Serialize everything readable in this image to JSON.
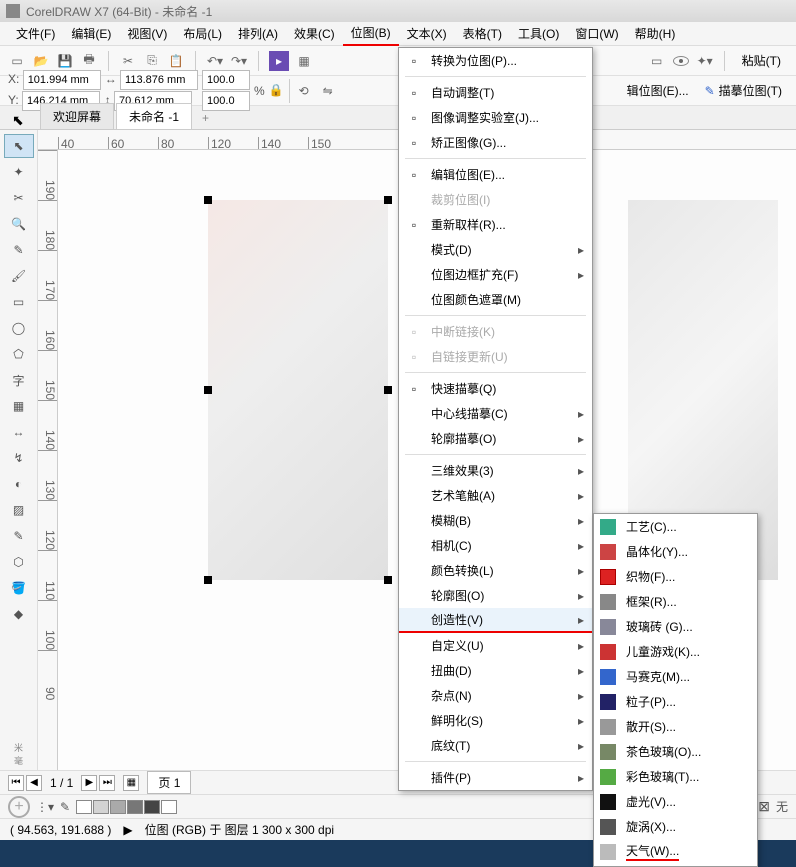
{
  "title": "CorelDRAW X7 (64-Bit) - 未命名 -1",
  "menubar": [
    "文件(F)",
    "编辑(E)",
    "视图(V)",
    "布局(L)",
    "排列(A)",
    "效果(C)",
    "位图(B)",
    "文本(X)",
    "表格(T)",
    "工具(O)",
    "窗口(W)",
    "帮助(H)"
  ],
  "menubar_highlighted_index": 6,
  "toolbar_paste": "粘贴(T)",
  "property_bar": {
    "x_label": "X:",
    "y_label": "Y:",
    "x_value": "101.994 mm",
    "y_value": "146.214 mm",
    "w_value": "113.876 mm",
    "h_value": "70.612 mm",
    "sx_value": "100.0",
    "sy_value": "100.0",
    "pct": "%",
    "edit_btn": "辑位图(E)...",
    "trace_btn": "描摹位图(T)"
  },
  "tabs": {
    "welcome": "欢迎屏幕",
    "doc": "未命名 -1",
    "add": "+"
  },
  "ruler_h": [
    "40",
    "60",
    "80",
    "120",
    "140",
    "150"
  ],
  "ruler_v": [
    "190",
    "180",
    "170",
    "160",
    "150",
    "140",
    "130",
    "120",
    "110",
    "100",
    "90"
  ],
  "page_nav": {
    "counter": "1 / 1",
    "page_label": "页 1"
  },
  "status_cursor": "( 94.563, 191.688 )",
  "status_info": "位图 (RGB) 于 图层 1 300 x 300 dpi",
  "status_none": "无",
  "bitmap_menu": [
    {
      "label": "转换为位图(P)...",
      "icon": "convert"
    },
    {
      "sep": true
    },
    {
      "label": "自动调整(T)",
      "icon": "auto"
    },
    {
      "label": "图像调整实验室(J)...",
      "icon": "lab"
    },
    {
      "label": "矫正图像(G)...",
      "icon": "straighten"
    },
    {
      "sep": true
    },
    {
      "label": "编辑位图(E)...",
      "icon": "edit"
    },
    {
      "label": "裁剪位图(I)",
      "disabled": true
    },
    {
      "label": "重新取样(R)...",
      "icon": "resample"
    },
    {
      "label": "模式(D)",
      "sub": true
    },
    {
      "label": "位图边框扩充(F)",
      "sub": true
    },
    {
      "label": "位图颜色遮罩(M)"
    },
    {
      "sep": true
    },
    {
      "label": "中断链接(K)",
      "disabled": true,
      "icon": "break"
    },
    {
      "label": "自链接更新(U)",
      "disabled": true,
      "icon": "update"
    },
    {
      "sep": true
    },
    {
      "label": "快速描摹(Q)",
      "icon": "trace"
    },
    {
      "label": "中心线描摹(C)",
      "sub": true
    },
    {
      "label": "轮廓描摹(O)",
      "sub": true
    },
    {
      "sep": true
    },
    {
      "label": "三维效果(3)",
      "sub": true
    },
    {
      "label": "艺术笔触(A)",
      "sub": true
    },
    {
      "label": "模糊(B)",
      "sub": true
    },
    {
      "label": "相机(C)",
      "sub": true
    },
    {
      "label": "颜色转换(L)",
      "sub": true
    },
    {
      "label": "轮廓图(O)",
      "sub": true
    },
    {
      "label": "创造性(V)",
      "sub": true,
      "highlighted": true
    },
    {
      "label": "自定义(U)",
      "sub": true
    },
    {
      "label": "扭曲(D)",
      "sub": true
    },
    {
      "label": "杂点(N)",
      "sub": true
    },
    {
      "label": "鲜明化(S)",
      "sub": true
    },
    {
      "label": "底纹(T)",
      "sub": true
    },
    {
      "sep": true
    },
    {
      "label": "插件(P)",
      "sub": true
    }
  ],
  "creative_menu": [
    {
      "label": "工艺(C)...",
      "color": "#3a8"
    },
    {
      "label": "晶体化(Y)...",
      "color": "#c44"
    },
    {
      "label": "织物(F)...",
      "color": "#d22",
      "border": true
    },
    {
      "label": "框架(R)...",
      "color": "#888"
    },
    {
      "label": "玻璃砖 (G)...",
      "color": "#889"
    },
    {
      "label": "儿童游戏(K)...",
      "color": "#c33"
    },
    {
      "label": "马赛克(M)...",
      "color": "#36c"
    },
    {
      "label": "粒子(P)...",
      "color": "#226"
    },
    {
      "label": "散开(S)...",
      "color": "#999"
    },
    {
      "label": "茶色玻璃(O)...",
      "color": "#786"
    },
    {
      "label": "彩色玻璃(T)...",
      "color": "#5a4"
    },
    {
      "label": "虚光(V)...",
      "color": "#111"
    },
    {
      "label": "旋涡(X)...",
      "color": "#555"
    },
    {
      "label": "天气(W)...",
      "color": "#bbb",
      "underline": true
    }
  ]
}
